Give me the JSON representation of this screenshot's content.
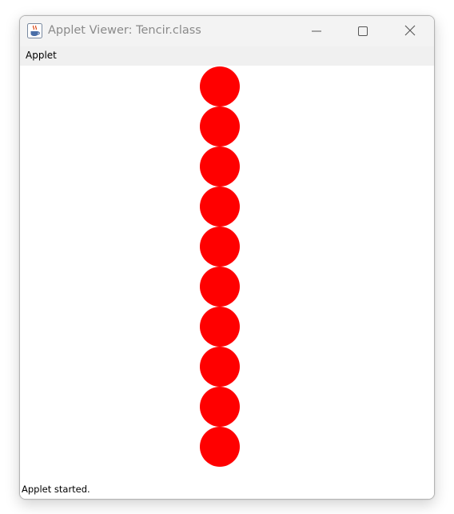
{
  "window": {
    "title": "Applet Viewer: Tencir.class"
  },
  "menubar": {
    "items": [
      {
        "label": "Applet"
      }
    ]
  },
  "canvas": {
    "shape_color": "#ff0000",
    "circle_count": 10
  },
  "status": {
    "text": "Applet started."
  },
  "icons": {
    "app": "java-cup-icon",
    "minimize": "minimize-icon",
    "maximize": "maximize-icon",
    "close": "close-icon"
  }
}
